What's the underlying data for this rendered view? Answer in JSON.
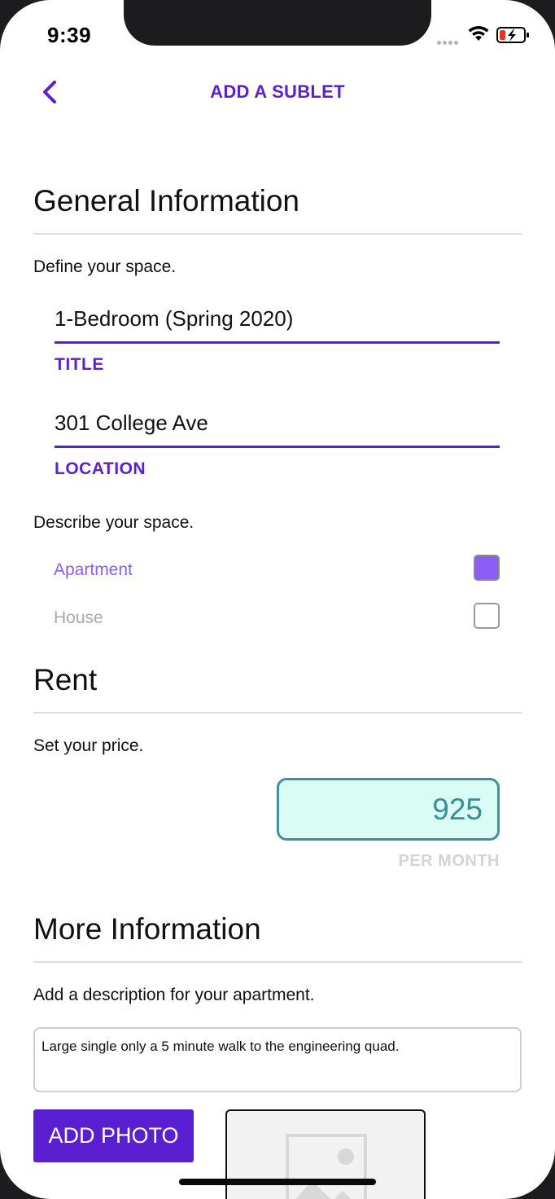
{
  "status_bar": {
    "time": "9:39"
  },
  "nav": {
    "title": "ADD A SUBLET"
  },
  "general": {
    "heading": "General Information",
    "define_hint": "Define your space.",
    "title_field": {
      "value": "1-Bedroom (Spring 2020)",
      "label": "TITLE"
    },
    "location_field": {
      "value": "301 College Ave",
      "label": "LOCATION"
    },
    "describe_hint": "Describe your space.",
    "options": [
      {
        "label": "Apartment",
        "checked": true
      },
      {
        "label": "House",
        "checked": false
      }
    ]
  },
  "rent": {
    "heading": "Rent",
    "hint": "Set your price.",
    "price": "925",
    "caption": "PER MONTH"
  },
  "more": {
    "heading": "More Information",
    "hint": "Add a description for your apartment.",
    "description": "Large single only a 5 minute walk to the engineering quad.",
    "add_photo_label": "ADD PHOTO"
  },
  "colors": {
    "accent": "#5a1fd1",
    "checkbox_checked": "#8c5cf6",
    "price_border": "#3f919b",
    "price_bg": "#d9fdf4"
  }
}
